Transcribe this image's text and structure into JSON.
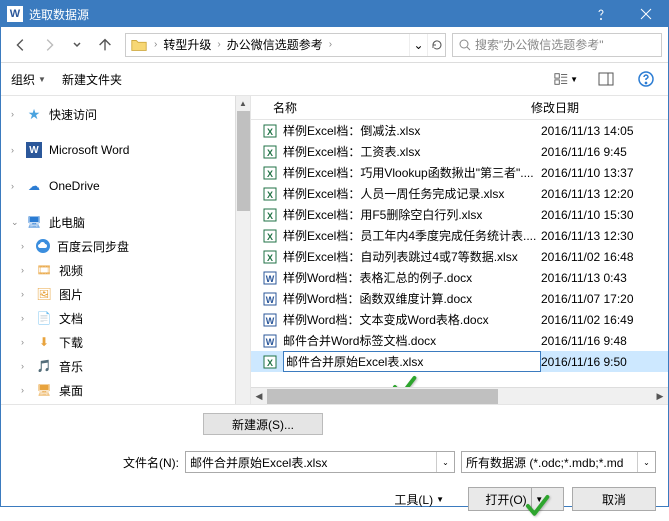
{
  "title": "选取数据源",
  "breadcrumb": {
    "level1": "转型升级",
    "level2": "办公微信选题参考"
  },
  "search_placeholder": "搜索\"办公微信选题参考\"",
  "toolbar": {
    "organize": "组织",
    "newfolder": "新建文件夹"
  },
  "sidebar": {
    "quick": "快速访问",
    "word": "Microsoft Word",
    "onedrive": "OneDrive",
    "pc": "此电脑",
    "baidu": "百度云同步盘",
    "video": "视频",
    "pictures": "图片",
    "docs": "文档",
    "downloads": "下载",
    "music": "音乐",
    "desktop": "桌面"
  },
  "columns": {
    "name": "名称",
    "date": "修改日期"
  },
  "files": [
    {
      "name": "样例Excel档：倒减法.xlsx",
      "date": "2016/11/13 14:05",
      "type": "excel"
    },
    {
      "name": "样例Excel档：工资表.xlsx",
      "date": "2016/11/16 9:45",
      "type": "excel"
    },
    {
      "name": "样例Excel档：巧用Vlookup函数揪出\"第三者\"....",
      "date": "2016/11/10 13:37",
      "type": "excel"
    },
    {
      "name": "样例Excel档：人员一周任务完成记录.xlsx",
      "date": "2016/11/13 12:20",
      "type": "excel"
    },
    {
      "name": "样例Excel档：用F5删除空白行列.xlsx",
      "date": "2016/11/10 15:30",
      "type": "excel"
    },
    {
      "name": "样例Excel档：员工年内4季度完成任务统计表....",
      "date": "2016/11/13 12:30",
      "type": "excel"
    },
    {
      "name": "样例Excel档：自动列表跳过4或7等数据.xlsx",
      "date": "2016/11/02 16:48",
      "type": "excel"
    },
    {
      "name": "样例Word档：表格汇总的例子.docx",
      "date": "2016/11/13 0:43",
      "type": "word"
    },
    {
      "name": "样例Word档：函数双维度计算.docx",
      "date": "2016/11/07 17:20",
      "type": "word"
    },
    {
      "name": "样例Word档：文本变成Word表格.docx",
      "date": "2016/11/02 16:49",
      "type": "word"
    },
    {
      "name": "邮件合并Word标签文档.docx",
      "date": "2016/11/16 9:48",
      "type": "word"
    },
    {
      "name": "邮件合并原始Excel表.xlsx",
      "date": "2016/11/16 9:50",
      "type": "excel",
      "selected": true,
      "editing": true
    }
  ],
  "new_source_btn": "新建源(S)...",
  "filename_label": "文件名(N):",
  "filename_value": "邮件合并原始Excel表.xlsx",
  "filter_value": "所有数据源 (*.odc;*.mdb;*.md",
  "tools_btn": "工具(L)",
  "open_btn": "打开(O)",
  "cancel_btn": "取消"
}
